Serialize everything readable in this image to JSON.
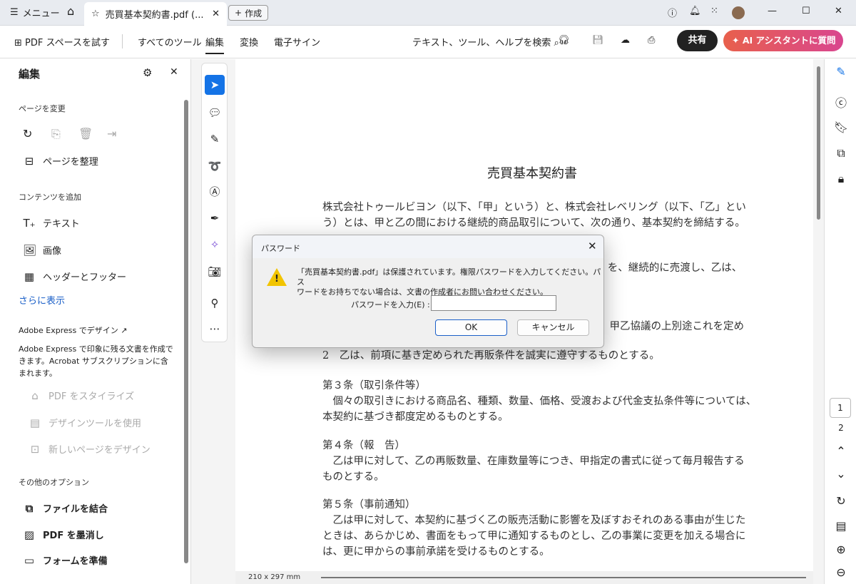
{
  "tabbar": {
    "menu": "メニュー",
    "tab_title": "売買基本契約書.pdf (...",
    "create": "作成"
  },
  "toolbar": {
    "try_pdf_space": "PDF スペースを試す",
    "all_tools": "すべてのツール",
    "edit": "編集",
    "convert": "変換",
    "esign": "電子サイン",
    "search": "テキスト、ツール、ヘルプを検索",
    "share": "共有",
    "ai": "AI アシスタントに質問"
  },
  "left": {
    "title": "編集",
    "sec_page": "ページを変更",
    "organize": "ページを整理",
    "sec_add": "コンテンツを追加",
    "text": "テキスト",
    "image": "画像",
    "header_footer": "ヘッダーとフッター",
    "more": "さらに表示",
    "express_title": "Adobe Express でデザイン",
    "express_desc1": "Adobe Express で印象に残る文書を作成で",
    "express_desc2": "きます。Acrobat サブスクリプションに含",
    "express_desc3": "まれます。",
    "stylize": "PDF をスタイライズ",
    "design_tools": "デザインツールを使用",
    "design_page": "新しいページをデザイン",
    "sec_other": "その他のオプション",
    "combine": "ファイルを結合",
    "redact": "PDF を墨消し",
    "form": "フォームを準備"
  },
  "doc": {
    "title": "売買基本契約書",
    "lines": [
      "株式会社トゥールビヨン（以下、「甲」という）と、株式会社レベリング（以下、「乙」とい",
      "う）とは、甲と乙の間における継続的商品取引について、次の通り、基本契約を締結する。",
      "。）を、継続的に売渡し、乙は、",
      "、甲乙協議の上別途これを定め",
      "2　乙は、前項に基き定められた再販条件を誠実に遵守するものとする。",
      "第３条（取引条件等）",
      "　個々の取引きにおける商品名、種類、数量、価格、受渡および代金支払条件等については、",
      "本契約に基づき都度定めるものとする。",
      "第４条（報　告）",
      "　乙は甲に対して、乙の再販数量、在庫数量等につき、甲指定の書式に従って毎月報告する",
      "ものとする。",
      "第５条（事前通知）",
      "　乙は甲に対して、本契約に基づく乙の販売活動に影響を及ぼすおそれのある事由が生じた",
      "ときは、あらかじめ、書面をもって甲に通知するものとし、乙の事業に変更を加える場合に",
      "は、更に甲からの事前承諾を受けるものとする。"
    ],
    "page_size": "210 x 297 mm"
  },
  "pages": {
    "current": "1",
    "next": "2"
  },
  "dialog": {
    "title": "パスワード",
    "msg1": "「売買基本契約書.pdf」は保護されています。権限パスワードを入力してください。パス",
    "msg2": "ワードをお持ちでない場合は、文書の作成者にお問い合わせください。",
    "label": "パスワードを入力(E) :",
    "value": "",
    "ok": "OK",
    "cancel": "キャンセル"
  }
}
